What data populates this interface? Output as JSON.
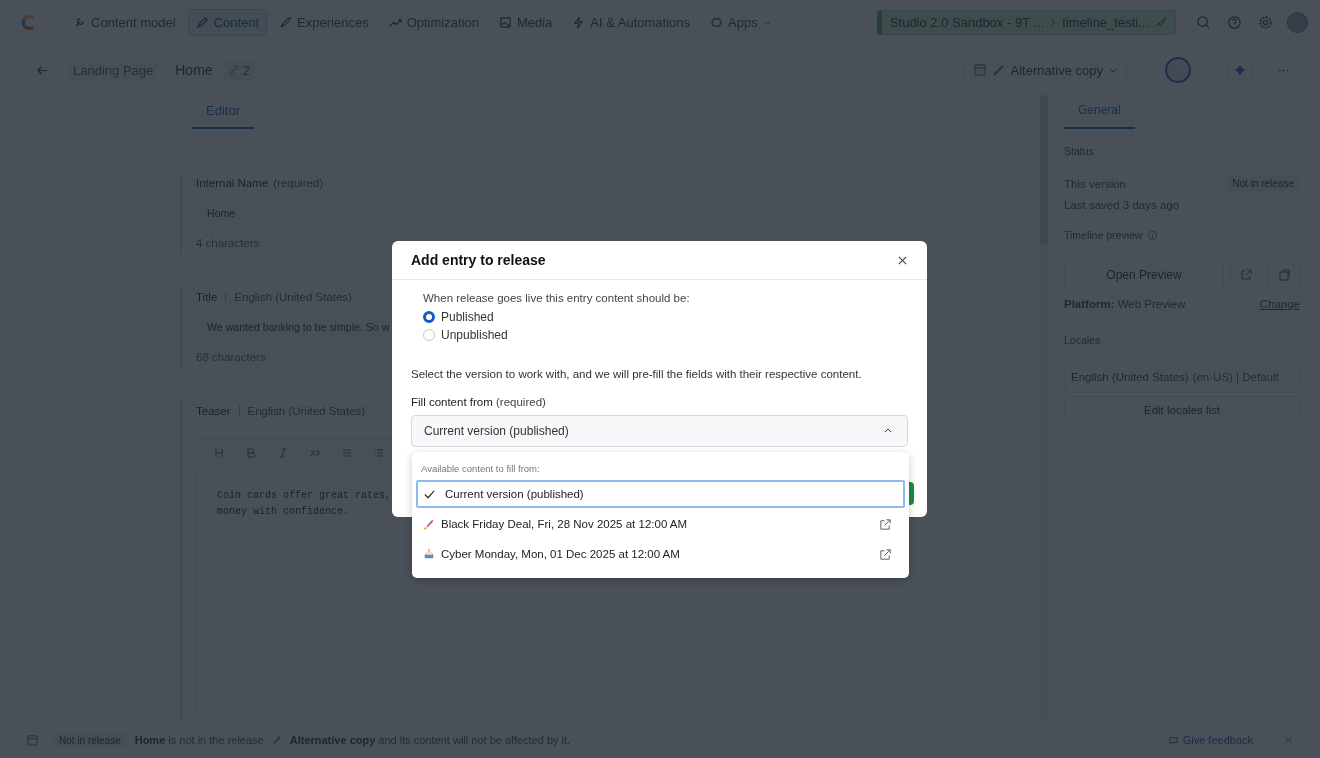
{
  "nav": {
    "items": [
      {
        "label": "Content model",
        "selected": false
      },
      {
        "label": "Content",
        "selected": true
      },
      {
        "label": "Experiences",
        "selected": false
      },
      {
        "label": "Optimization",
        "selected": false
      },
      {
        "label": "Media",
        "selected": false
      },
      {
        "label": "AI & Automations",
        "selected": false
      },
      {
        "label": "Apps",
        "selected": false
      }
    ]
  },
  "environment": {
    "space": "Studio 2.0 Sandbox - 9T ...",
    "branch": "timeline_testi..."
  },
  "entry": {
    "content_type": "Landing Page",
    "title": "Home",
    "references": "2",
    "release": "Alternative copy"
  },
  "editor": {
    "tabs": [
      {
        "label": "Editor",
        "selected": true
      }
    ],
    "fields": [
      {
        "kind": "text",
        "label": "Internal Name",
        "hint": "(required)",
        "value": "Home",
        "count": "4 characters"
      },
      {
        "kind": "text",
        "label": "Title",
        "locale": "English (United States)",
        "value": "We wanted banking to be simple. So w",
        "count": "68 characters"
      },
      {
        "kind": "rich",
        "label": "Teaser",
        "locale": "English (United States)",
        "lines": [
          "Coin cards offer great rates,",
          "money with confidence."
        ]
      }
    ]
  },
  "sidebar": {
    "tabs": [
      {
        "label": "General",
        "selected": true
      }
    ],
    "status_title": "Status",
    "version_label": "This version",
    "version_badge": "Not in release",
    "last_saved": "Last saved 3 days ago",
    "preview_title": "Timeline preview",
    "open_preview": "Open Preview",
    "platform_label": "Platform:",
    "platform": "Web Preview",
    "change": "Change",
    "locales_title": "Locales",
    "locale": "English (United States)",
    "locale_detail": "(en-US) | Default",
    "edit_locales": "Edit locales list"
  },
  "modal": {
    "title": "Add entry to release",
    "prompt": "When release goes live this entry content should be:",
    "options": [
      {
        "label": "Published",
        "selected": true
      },
      {
        "label": "Unpublished",
        "selected": false
      }
    ],
    "description": "Select the version to work with, and we will pre-fill the fields with their respective content.",
    "fill_label": "Fill content from",
    "fill_hint": "(required)",
    "fill_value": "Current version (published)",
    "expanded": true,
    "menu_heading": "Available content to fill from:",
    "menu": [
      {
        "kind": "current",
        "label": "Current version (published)",
        "selected": true
      },
      {
        "kind": "release",
        "label": "Black Friday Deal, Fri, 28 Nov 2025 at 12:00 AM",
        "selected": false
      },
      {
        "kind": "release",
        "label": "Cyber Monday, Mon, 01 Dec 2025 at 12:00 AM",
        "selected": false
      }
    ]
  },
  "notice": {
    "badge": "Not in release",
    "before": "**Home** is not in the release",
    "after": "**Alternative copy** and its content will not be affected by it.",
    "feedback": "Give feedback"
  }
}
